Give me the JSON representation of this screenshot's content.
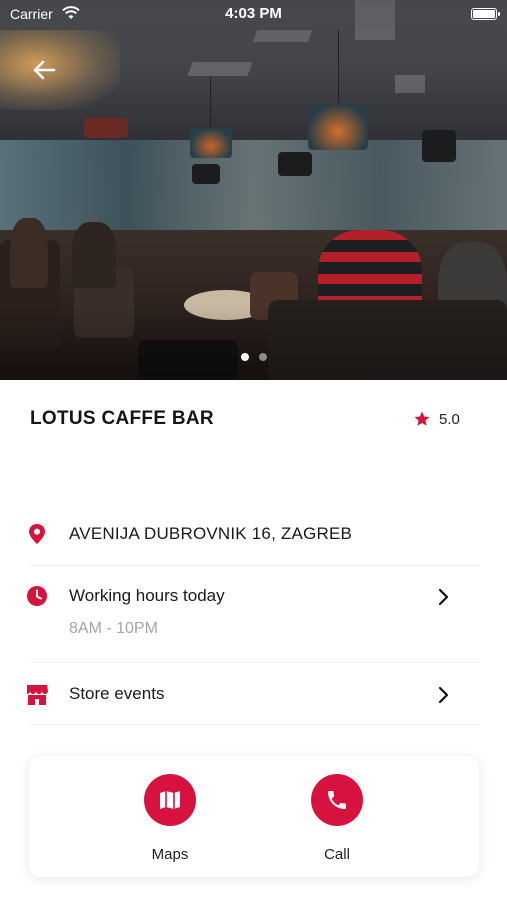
{
  "status_bar": {
    "carrier": "Carrier",
    "time": "4:03 PM"
  },
  "hero": {
    "pager_count": 2,
    "pager_active": 0
  },
  "venue": {
    "name": "LOTUS CAFFE BAR",
    "rating": "5.0"
  },
  "address": {
    "text": "AVENIJA DUBROVNIK 16, ZAGREB",
    "icon": "map-pin-icon"
  },
  "hours": {
    "label": "Working hours today",
    "value": "8AM -  10PM",
    "icon": "clock-icon"
  },
  "events": {
    "label": "Store events",
    "icon": "store-icon"
  },
  "actions": {
    "maps": {
      "label": "Maps",
      "icon": "map-icon"
    },
    "call": {
      "label": "Call",
      "icon": "phone-icon"
    }
  },
  "colors": {
    "accent": "#d8123f",
    "divider": "#efefef",
    "muted_text": "#a5a5a5"
  }
}
